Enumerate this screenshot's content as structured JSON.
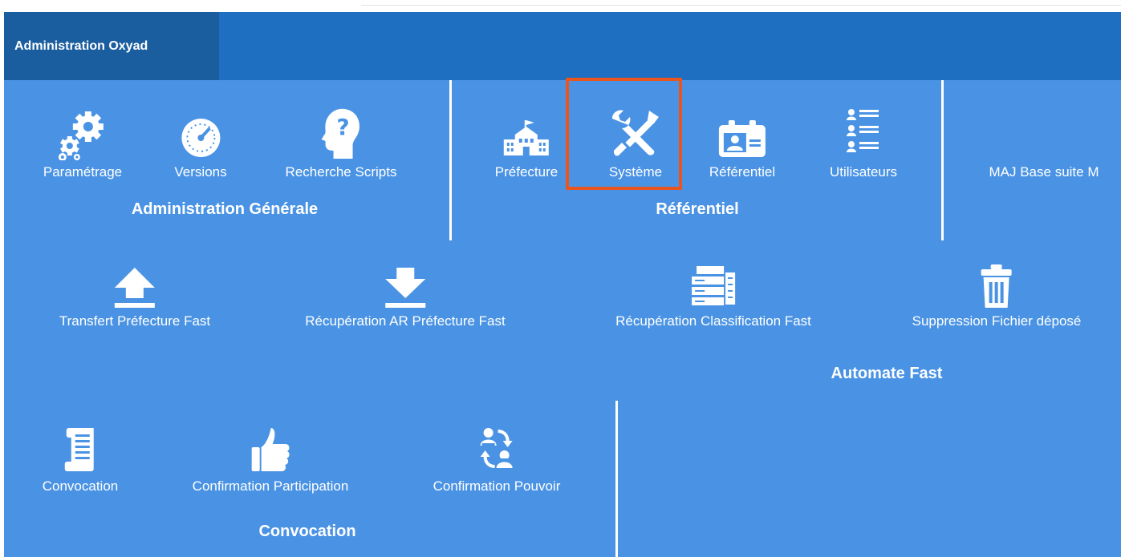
{
  "header": {
    "tab_title": "Administration Oxyad"
  },
  "groups": {
    "admin": {
      "title": "Administration Générale",
      "items": [
        {
          "label": "Paramétrage",
          "icon": "gears-icon"
        },
        {
          "label": "Versions",
          "icon": "gauge-icon"
        },
        {
          "label": "Recherche Scripts",
          "icon": "head-question-icon"
        }
      ]
    },
    "referentiel": {
      "title": "Référentiel",
      "items": [
        {
          "label": "Préfecture",
          "icon": "building-icon"
        },
        {
          "label": "Système",
          "icon": "tools-icon"
        },
        {
          "label": "Référentiel",
          "icon": "id-card-icon"
        },
        {
          "label": "Utilisateurs",
          "icon": "user-list-icon"
        }
      ]
    },
    "maj": {
      "items": [
        {
          "label": "MAJ Base suite M"
        }
      ]
    },
    "automate": {
      "title": "Automate Fast",
      "items": [
        {
          "label": "Transfert Préfecture Fast",
          "icon": "upload-icon"
        },
        {
          "label": "Récupération AR Préfecture Fast",
          "icon": "download-icon"
        },
        {
          "label": "Récupération Classification Fast",
          "icon": "classification-icon"
        },
        {
          "label": "Suppression Fichier déposé",
          "icon": "trash-icon"
        }
      ]
    },
    "convocation": {
      "title": "Convocation",
      "items": [
        {
          "label": "Convocation",
          "icon": "scroll-icon"
        },
        {
          "label": "Confirmation Participation",
          "icon": "thumbs-up-icon"
        },
        {
          "label": "Confirmation Pouvoir",
          "icon": "users-exchange-icon"
        }
      ]
    }
  },
  "colors": {
    "header": "#1e6fc1",
    "header_tab": "#1b5e9f",
    "panel": "#4a93e4",
    "highlight": "#e8551f"
  }
}
